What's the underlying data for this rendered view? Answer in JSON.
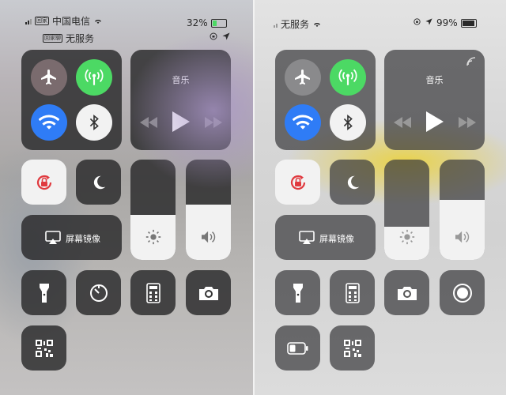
{
  "left": {
    "status": {
      "tag1": "回家",
      "carrier": "中国电信",
      "tag2": "回家聊",
      "carrier2": "无服务",
      "battery": "32%"
    },
    "music_title": "音乐",
    "mirroring_label": "屏幕镜像",
    "brightness_level": 0.45,
    "volume_level": 0.55
  },
  "right": {
    "status": {
      "carrier": "无服务",
      "battery": "99%"
    },
    "music_title": "音乐",
    "mirroring_label": "屏幕镜像",
    "brightness_level": 0.33,
    "volume_level": 0.6
  },
  "colors": {
    "airplane_off": "#7a6b6e",
    "cellular_on": "#4cd964",
    "wifi_on": "#2f7cf6",
    "bluetooth_on": "#f2f2f2",
    "lock_red": "#e0393e"
  }
}
